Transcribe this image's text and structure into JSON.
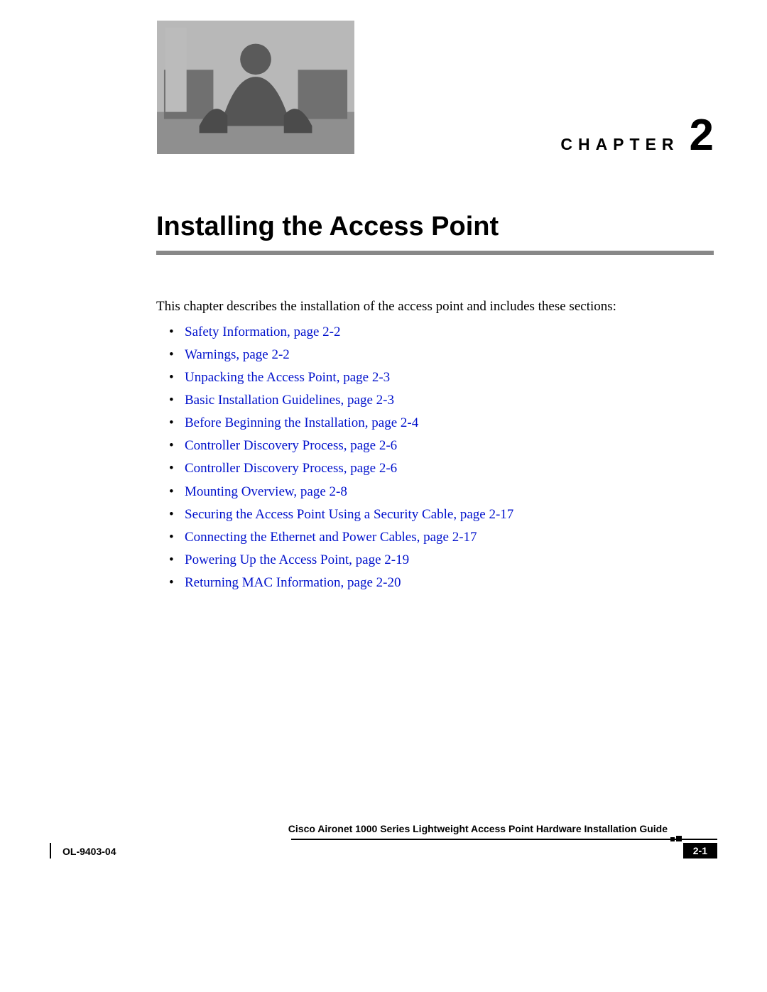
{
  "chapter": {
    "label": "CHAPTER",
    "number": "2",
    "title": "Installing the Access Point"
  },
  "intro": "This chapter describes the installation of the access point and includes these sections:",
  "sections": [
    "Safety Information, page 2-2",
    "Warnings, page 2-2",
    "Unpacking the Access Point, page 2-3",
    "Basic Installation Guidelines, page 2-3",
    "Before Beginning the Installation, page 2-4",
    "Controller Discovery Process, page 2-6",
    "Controller Discovery Process, page 2-6",
    "Mounting Overview, page 2-8",
    "Securing the Access Point Using a Security Cable, page 2-17",
    "Connecting the Ethernet and Power Cables, page 2-17",
    "Powering Up the Access Point, page 2-19",
    "Returning MAC Information, page 2-20"
  ],
  "footer": {
    "book_title": "Cisco Aironet 1000 Series Lightweight Access Point Hardware Installation Guide",
    "doc_code": "OL-9403-04",
    "page_number": "2-1"
  }
}
